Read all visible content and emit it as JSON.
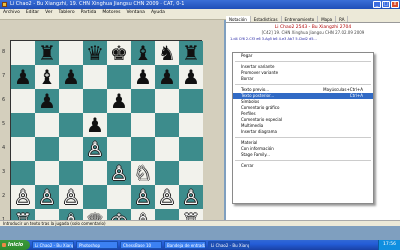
{
  "window": {
    "title": "Li Chao2 - Bu Xiangzhi, 19. CHN Xinghua Jiangsu CHN 2009 · CAT, 0-1",
    "min": "_",
    "max": "□",
    "close": "x"
  },
  "menubar": [
    "Archivo",
    "Editar",
    "Ver",
    "Tablero",
    "Partida",
    "Motores",
    "Ventana",
    "Ayuda"
  ],
  "board": {
    "ranks": [
      "8",
      "7",
      "6",
      "5",
      "4",
      "3",
      "2",
      "1"
    ],
    "files": [
      "a",
      "b",
      "c",
      "d",
      "e",
      "f",
      "g",
      "h"
    ],
    "rows": [
      [
        "",
        "♜",
        "",
        "♛",
        "♚",
        "♝",
        "♞",
        "♜"
      ],
      [
        "♟",
        "♝",
        "♟",
        "",
        "",
        "♟",
        "♟",
        "♟"
      ],
      [
        "",
        "♟",
        "",
        "",
        "♟",
        "",
        "",
        ""
      ],
      [
        "",
        "",
        "",
        "♟",
        "",
        "",
        "",
        ""
      ],
      [
        "",
        "",
        "",
        "♙",
        "",
        "",
        "",
        ""
      ],
      [
        "",
        "",
        "",
        "",
        "♙",
        "♘",
        "",
        ""
      ],
      [
        "♙",
        "♙",
        "♙",
        "",
        "",
        "♙",
        "♙",
        "♙"
      ],
      [
        "♖",
        "",
        "♗",
        "♕",
        "♔",
        "♗",
        "",
        "♖"
      ]
    ]
  },
  "tabs": [
    "Notación",
    "Estadísticas",
    "Entrenamiento",
    "Mapa",
    "RA"
  ],
  "game": {
    "header": "Li Chao2 2543 - Bu Xiangzhi 2704",
    "subheader": "[C42] 19. CHN Xinghua Jiangsu CHN 27.02.09 2009",
    "moves": "1.d4 Cf6 2.Cf3 e6 3.Ag5 b6 4.e3 Ab7 5.Cbd2 d5..."
  },
  "context_menu": [
    {
      "label": "Pegar",
      "shortcut": "",
      "highlight": false
    },
    {
      "sep": true
    },
    {
      "label": "Insertar variante",
      "shortcut": "",
      "highlight": false
    },
    {
      "label": "Promover variante",
      "shortcut": "",
      "highlight": false
    },
    {
      "label": "Borrar",
      "shortcut": "",
      "highlight": false
    },
    {
      "sep": true
    },
    {
      "label": "Texto previo...",
      "shortcut": "Mayúsculas+Ctrl+A",
      "highlight": false
    },
    {
      "label": "Texto posterior...",
      "shortcut": "Ctrl+A",
      "highlight": true
    },
    {
      "label": "Símbolos",
      "shortcut": "",
      "highlight": false
    },
    {
      "label": "Comentario gráfico",
      "shortcut": "",
      "highlight": false
    },
    {
      "label": "Perfiles",
      "shortcut": "",
      "highlight": false
    },
    {
      "label": "Comentario especial",
      "shortcut": "",
      "highlight": false
    },
    {
      "label": "Multimedia",
      "shortcut": "",
      "highlight": false
    },
    {
      "label": "Insertar diagrama",
      "shortcut": "",
      "highlight": false
    },
    {
      "sep": true
    },
    {
      "label": "Material",
      "shortcut": "",
      "highlight": false
    },
    {
      "label": "Con información",
      "shortcut": "",
      "highlight": false
    },
    {
      "label": "Stage Family...",
      "shortcut": "",
      "highlight": false
    },
    {
      "sep": true
    },
    {
      "label": "Cerrar",
      "shortcut": "",
      "highlight": false
    }
  ],
  "status": "Introducir un texto tras la jugada (solo comentario)",
  "taskbar": {
    "start": "Inicio",
    "tasks": [
      "Li Chao2 - Bu Xiangzhi",
      "Photoshop",
      "ChessBase 10",
      "Bandeja de entrada",
      "Li Chao2 - Bu Xiangzhi"
    ],
    "active_index": 4,
    "clock": "17:56"
  }
}
